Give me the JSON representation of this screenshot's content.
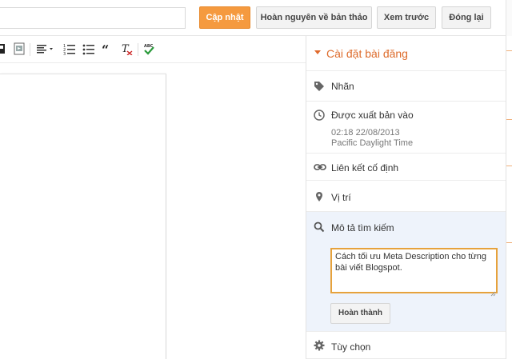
{
  "header": {
    "title_value": "",
    "buttons": {
      "update": "Cập nhật",
      "revert": "Hoàn nguyên về bản thảo",
      "preview": "Xem trước",
      "close": "Đóng lại"
    }
  },
  "toolbar": {
    "icons": [
      "insert-image-icon",
      "insert-video-icon",
      "align-icon",
      "numbered-list-icon",
      "bullet-list-icon",
      "quote-icon",
      "clear-formatting-icon",
      "spellcheck-icon"
    ]
  },
  "sidebar": {
    "header": "Cài đặt bài đăng",
    "labels": "Nhãn",
    "published": {
      "label": "Được xuất bản vào",
      "datetime": "02:18 22/08/2013",
      "timezone": "Pacific Daylight Time"
    },
    "permalink": "Liên kết cố định",
    "location": "Vị trí",
    "search_description": {
      "label": "Mô tả tìm kiếm",
      "value": "Cách tối ưu Meta Description cho từng bài viết Blogspot.",
      "done_button": "Hoàn thành"
    },
    "options": "Tùy chọn"
  },
  "colors": {
    "accent": "#dd6b2b",
    "primary_button": "#f59a3f",
    "active_section_bg": "#eef3fb",
    "focus_border": "#e6a23c"
  }
}
